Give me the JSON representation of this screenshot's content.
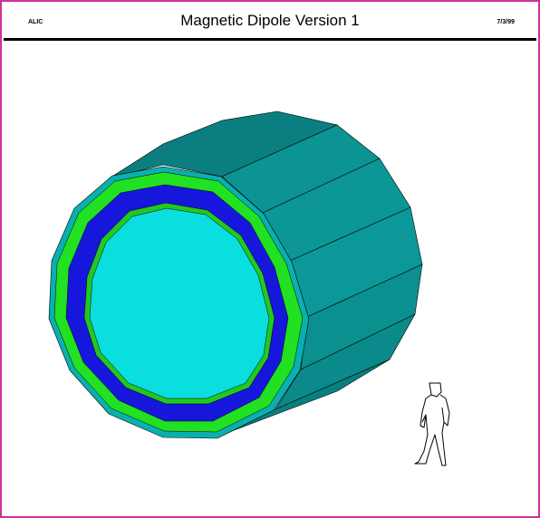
{
  "header": {
    "left_label": "ALIC",
    "title": "Magnetic Dipole Version 1",
    "date": "7/3/99"
  },
  "colors": {
    "frame_border": "#cc3399",
    "yoke_outer": "#0a9c9c",
    "yoke_side": "#098f8f",
    "yoke_top": "#0b8585",
    "coil_outer": "#1ee81e",
    "coil_inner": "#1414e0",
    "bore": "#0adede",
    "edge_outline": "#000000"
  },
  "figure": {
    "object": "magnet-yoke",
    "scale_reference": "human-figure"
  }
}
